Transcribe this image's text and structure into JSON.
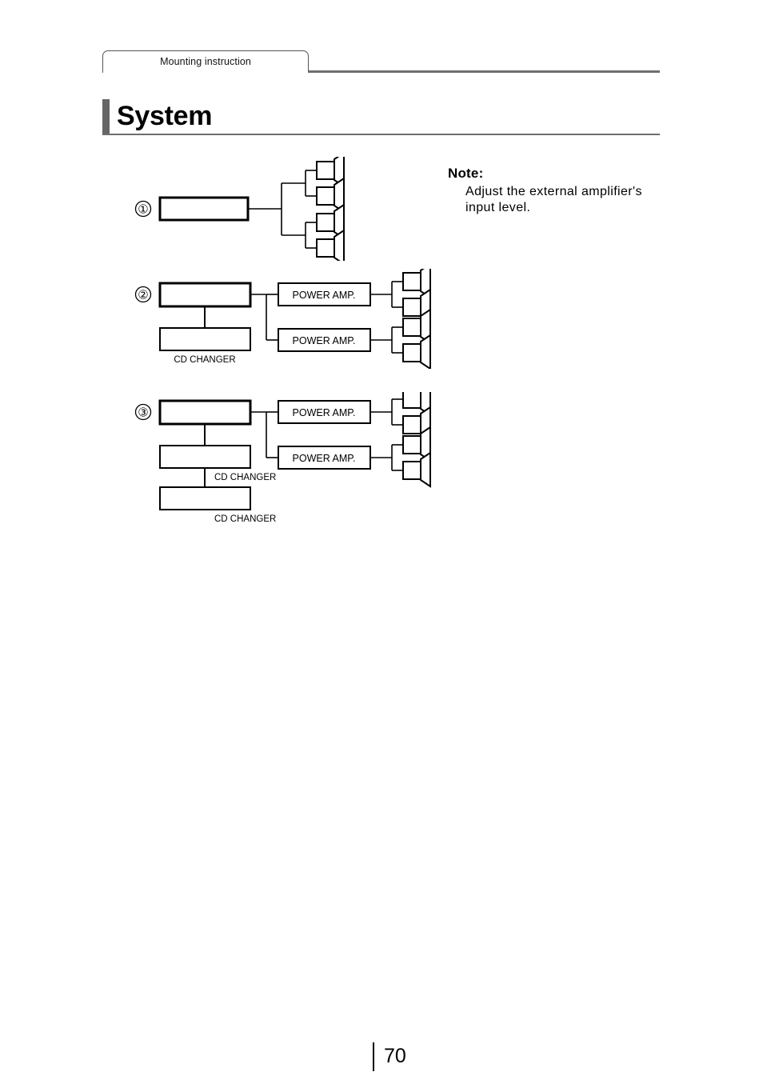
{
  "header": {
    "tab_label": "Mounting instruction"
  },
  "title": {
    "text": "System"
  },
  "note": {
    "heading": "Note:",
    "body": "Adjust the external amplifier's input level."
  },
  "diagrams": [
    {
      "number": "①",
      "head_unit_label": "",
      "amps": [],
      "changers": [],
      "speaker_pairs": 4,
      "description": "Head unit directly driving four speakers through a two-level split"
    },
    {
      "number": "②",
      "head_unit_label": "",
      "amps": [
        "POWER AMP.",
        "POWER AMP."
      ],
      "changers": [
        "CD CHANGER"
      ],
      "speaker_pairs": 4,
      "description": "Head unit with one CD changer feeding two power amps, each driving a speaker pair"
    },
    {
      "number": "③",
      "head_unit_label": "",
      "amps": [
        "POWER AMP.",
        "POWER AMP."
      ],
      "changers": [
        "CD CHANGER",
        "CD CHANGER"
      ],
      "speaker_pairs": 4,
      "description": "Head unit with two daisy-chained CD changers feeding two power amps, each driving a speaker pair"
    }
  ],
  "footer": {
    "page_number": "70"
  },
  "colors": {
    "rule": "#6e6e6e",
    "title_bar": "#666666",
    "ink": "#000000",
    "page_background": "#ffffff"
  }
}
